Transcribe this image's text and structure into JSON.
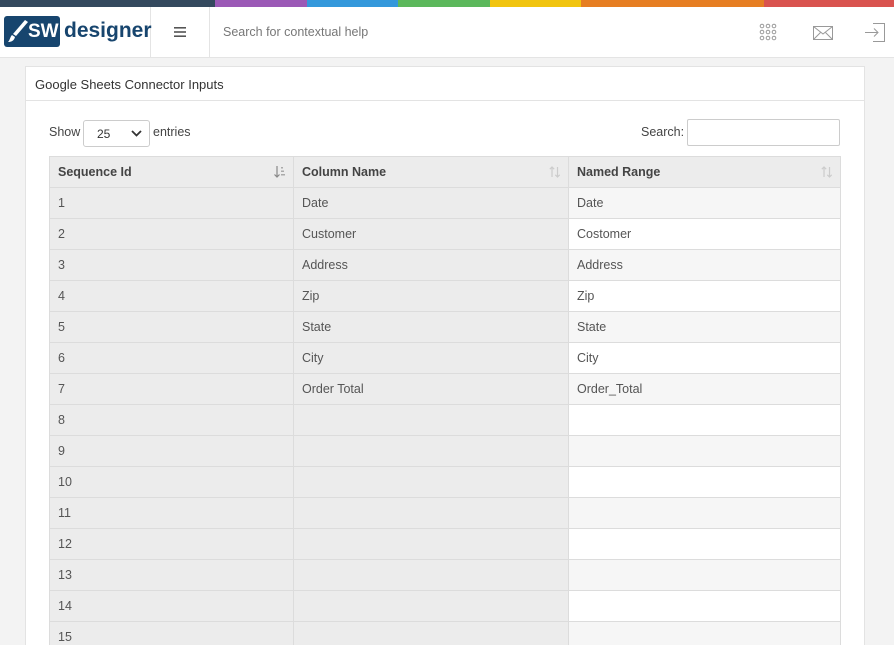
{
  "colors": {
    "strip": [
      "#34495e",
      "#9b59b6",
      "#3498db",
      "#5cb85c",
      "#f1c40f",
      "#e67e22",
      "#d9534f"
    ],
    "brand": "#17456e"
  },
  "header": {
    "logo_badge": "SW",
    "logo_text": "designer",
    "menu_icon": "hamburger-icon",
    "search_placeholder": "Search for contextual help",
    "icons": [
      "apps-grid-icon",
      "mail-icon",
      "logout-icon"
    ]
  },
  "panel": {
    "title": "Google Sheets Connector Inputs",
    "show_label": "Show",
    "page_length": "25",
    "entries_label": "entries",
    "search_label": "Search:",
    "search_value": ""
  },
  "table": {
    "columns": [
      "Sequence Id",
      "Column Name",
      "Named Range"
    ],
    "rows": [
      [
        "1",
        "Date",
        "Date"
      ],
      [
        "2",
        "Customer",
        "Costomer"
      ],
      [
        "3",
        "Address",
        "Address"
      ],
      [
        "4",
        "Zip",
        "Zip"
      ],
      [
        "5",
        "State",
        "State"
      ],
      [
        "6",
        "City",
        "City"
      ],
      [
        "7",
        "Order Total",
        "Order_Total"
      ],
      [
        "8",
        "",
        ""
      ],
      [
        "9",
        "",
        ""
      ],
      [
        "10",
        "",
        ""
      ],
      [
        "11",
        "",
        ""
      ],
      [
        "12",
        "",
        ""
      ],
      [
        "13",
        "",
        ""
      ],
      [
        "14",
        "",
        ""
      ],
      [
        "15",
        "",
        ""
      ]
    ]
  }
}
